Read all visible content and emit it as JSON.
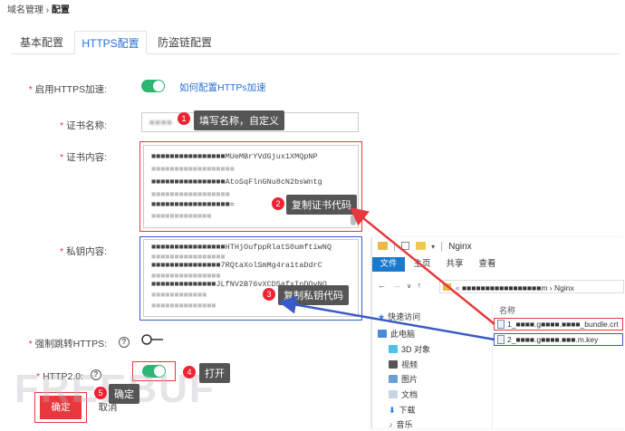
{
  "breadcrumb": {
    "parent": "域名管理",
    "sep": "›",
    "current": "配置"
  },
  "tabs": [
    {
      "label": "基本配置"
    },
    {
      "label": "HTTPS配置"
    },
    {
      "label": "防盗链配置"
    }
  ],
  "form": {
    "https_enable": {
      "label": "启用HTTPS加速:",
      "toggle_on": true,
      "help_link": "如何配置HTTPs加速"
    },
    "cert_name": {
      "label": "证书名称:",
      "value": "■■■■"
    },
    "cert_content": {
      "label": "证书内容:",
      "lines": [
        "■■■■■■■■■■■■■■■■MUeMBrYVdGjux1XMQpNP",
        "■■■■■■■■■■■■■■■■■■",
        "■■■■■■■■■■■■■■■■AtoSqFlnGNu8cN2bsWntg",
        "■■■■■■■■■■■■■■■■■",
        "■■■■■■■■■■■■■■■■■=",
        "■■■■■■■■■■■■■"
      ]
    },
    "private_key": {
      "label": "私钥内容:",
      "lines": [
        "■■■■■■■■■■■■■■■■HTHjOufppRlatS0umftiwNQ",
        "■■■■■■■■■■■■■■■■",
        "■■■■■■■■■■■■■■■7RQtaXolSmMg4ra1taDdrC",
        "■■■■■■■■■■■■■■■",
        "■■■■■■■■■■■■■■JLfNV2B76vXCDSafxInDOvNO",
        "■■■■■■■■■■■■",
        "■■■■■■■■■■■■■■"
      ]
    },
    "force_redirect": {
      "label": "强制跳转HTTPS:",
      "toggle_on": false,
      "help_icon": "?"
    },
    "http2": {
      "label": "HTTP2.0:",
      "toggle_on": true,
      "help_icon": "?"
    },
    "buttons": {
      "confirm": "确定",
      "cancel": "取消"
    },
    "required_mark": "*"
  },
  "annotations": [
    {
      "num": "1",
      "text": "填写名称，自定义"
    },
    {
      "num": "2",
      "text": "复制证书代码"
    },
    {
      "num": "3",
      "text": "复制私钥代码"
    },
    {
      "num": "4",
      "text": "打开"
    },
    {
      "num": "5",
      "text": "确定"
    }
  ],
  "explorer": {
    "title": "Nginx",
    "ribbon_tabs": [
      "文件",
      "主页",
      "共享",
      "查看"
    ],
    "path": "■■■■■■■■■■■■■■■■■m › Nginx",
    "column_header": "名称",
    "tree": [
      "快速访问",
      "此电脑",
      "3D 对象",
      "视频",
      "图片",
      "文档",
      "下载",
      "音乐"
    ],
    "files": [
      "1_■■■■.g■■■■.■■■■_bundle.crt",
      "2_■■■■.g■■■■.■■■.m.key"
    ]
  },
  "colors": {
    "accent": "#2a6fd6",
    "toggle_on": "#2bb673",
    "required": "#e33",
    "highlight_red": "#e8383d",
    "highlight_blue": "#3a5bc7",
    "confirm_btn": "#e8383d"
  },
  "watermark": "FREEBUF"
}
